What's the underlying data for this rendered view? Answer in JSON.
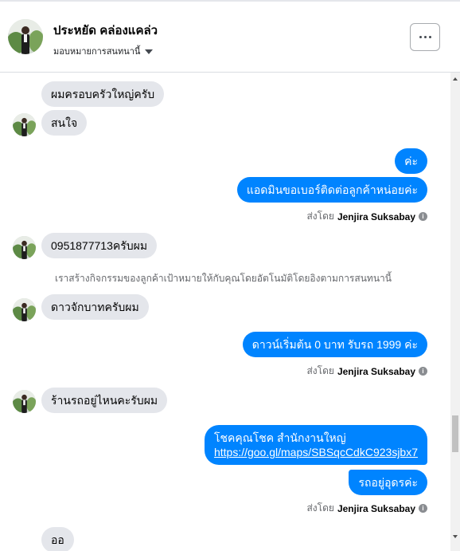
{
  "header": {
    "contact_name": "ประหยัด คล่องแคล่ว",
    "assign_label": "มอบหมายการสนทนานี้",
    "more_label": "···"
  },
  "messages": {
    "m1": "ผมครอบครัวใหญ่ครับ",
    "m2": "สนใจ",
    "m3": "ค่ะ",
    "m4": "แอดมินขอเบอร์ติดต่อลูกค้าหน่อยค่ะ",
    "m5": "0951877713ครับผม",
    "m6": "ดาวจักบาทครับผม",
    "m7": "ดาวน์เริ่มต้น 0 บาท รับรถ 1999 ค่ะ",
    "m8": "ร้านรถอยู่ไหนคะรับผม",
    "m9_line1": "โชคคุณโชค สำนักงานใหญ่",
    "m9_link": "https://goo.gl/maps/SBSqcCdkC923sjbx7",
    "m10": "รถอยู่อุดรค่ะ",
    "m11": "ออ"
  },
  "system_note": "เราสร้างกิจกรรมของลูกค้าเป้าหมายให้กับคุณโดยอัตโนมัติโดยอิงตามการสนทนานี้",
  "sent_by": {
    "prefix": "ส่งโดย",
    "agent": "Jenjira Suksabay",
    "info_icon": "i"
  },
  "colors": {
    "outgoing": "#0084ff",
    "incoming": "#e4e6eb"
  }
}
